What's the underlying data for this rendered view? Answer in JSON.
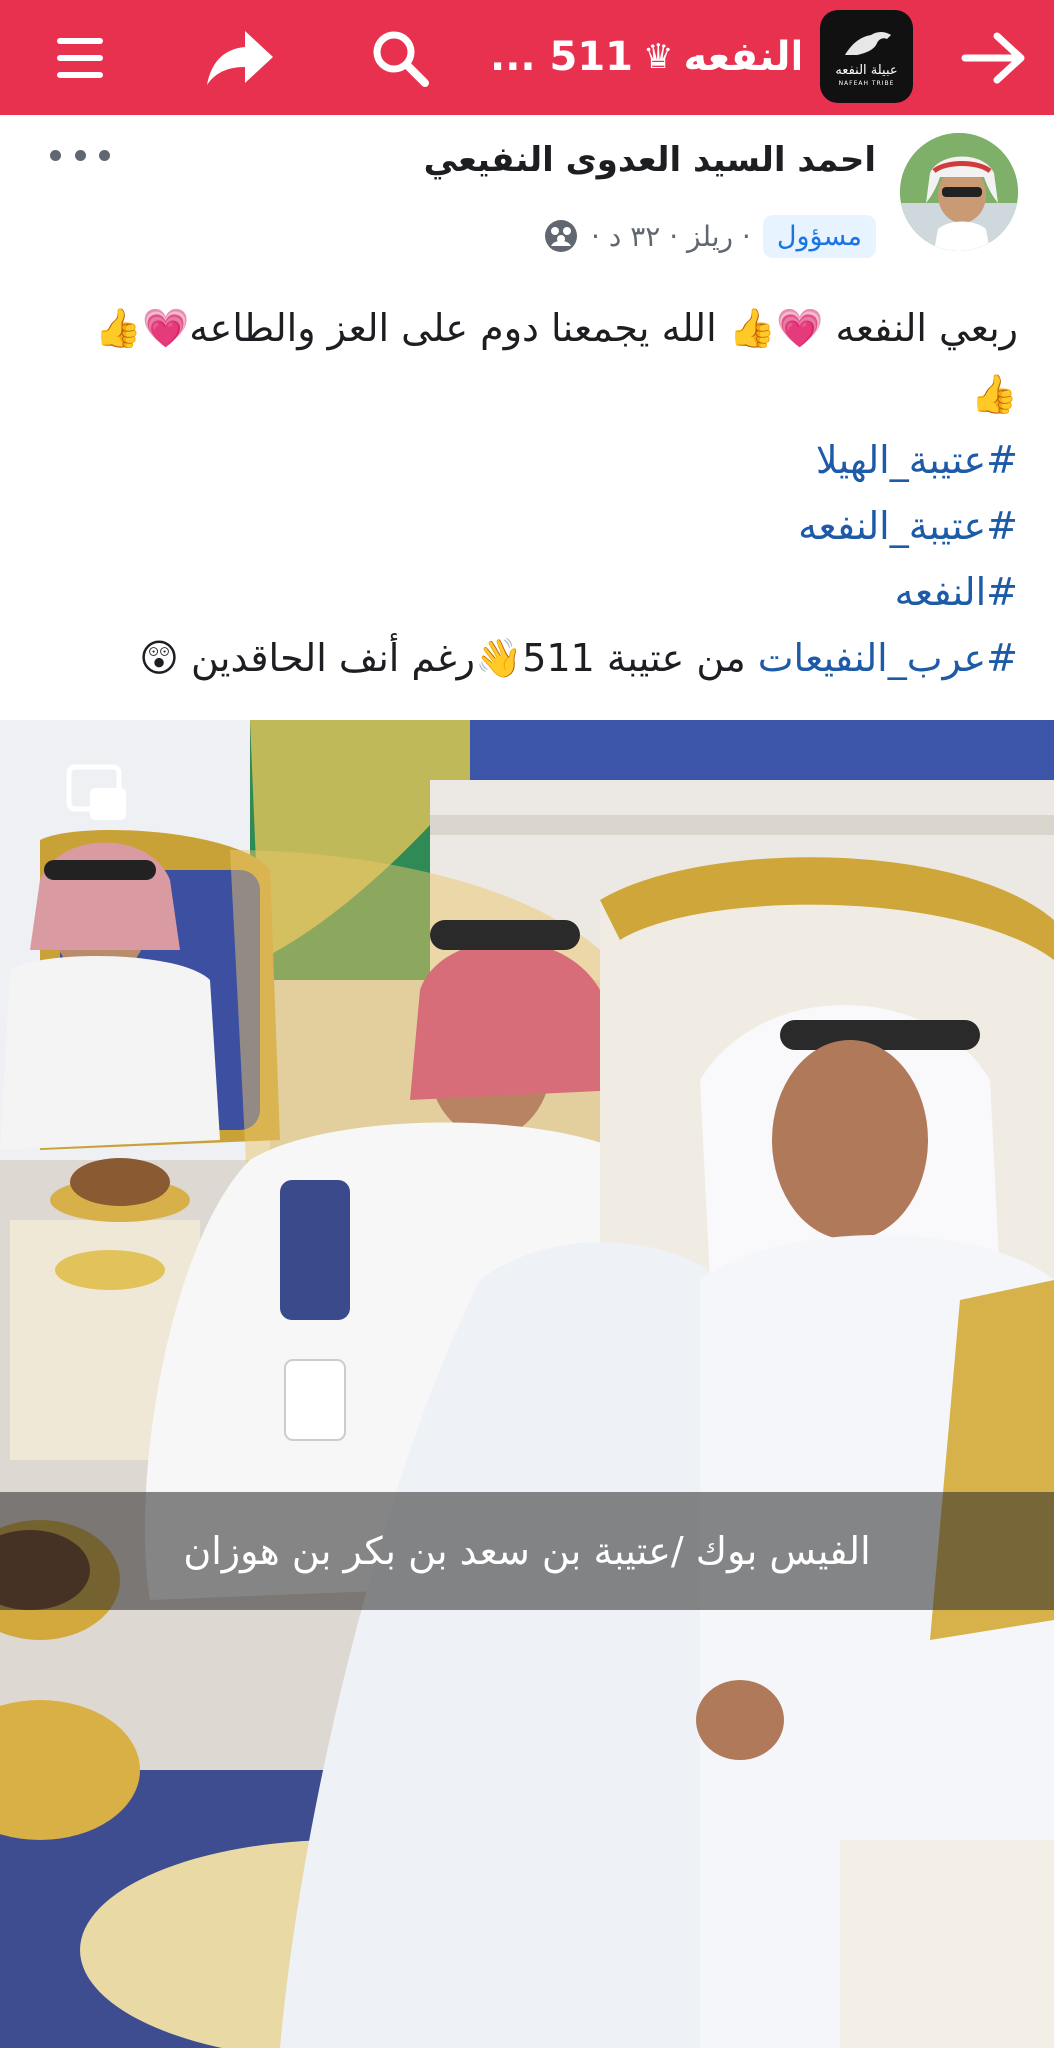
{
  "topbar": {
    "title": "النفعه",
    "title_suffix": "511 ...",
    "crown": "♛",
    "logo_text": "عبيلة النفعه",
    "logo_sub": "NAFEAH TRIBE",
    "icons": [
      "menu-icon",
      "share-icon",
      "search-icon",
      "back-arrow-icon"
    ],
    "color": "#e8304f"
  },
  "post": {
    "author": "احمد السيد العدوى النفيعي",
    "badge": "مسؤول",
    "meta": "· ريلز · ٣٢ د ·",
    "lines": [
      {
        "text": "ربعي النفعه 💗👍 الله يجمعنا دوم على العز والطاعه💗👍"
      },
      {
        "text": "👍"
      },
      {
        "hashtag": "#عتيبة_الهيلا"
      },
      {
        "hashtag": "#عتيبة_النفعه"
      },
      {
        "hashtag": "#النفعه"
      },
      {
        "hashtag": "#عرب_النفيعات",
        "text": " من عتيبة 511👋رغم أنف الحاقدين 😲"
      }
    ]
  },
  "video": {
    "caption": "الفيس بوك /عتيبة بن سعد بن بكر بن هوزان"
  },
  "colors": {
    "hashtag": "#1d5aa8",
    "badge_bg": "#e7f3ff",
    "badge_text": "#1b74e4"
  }
}
